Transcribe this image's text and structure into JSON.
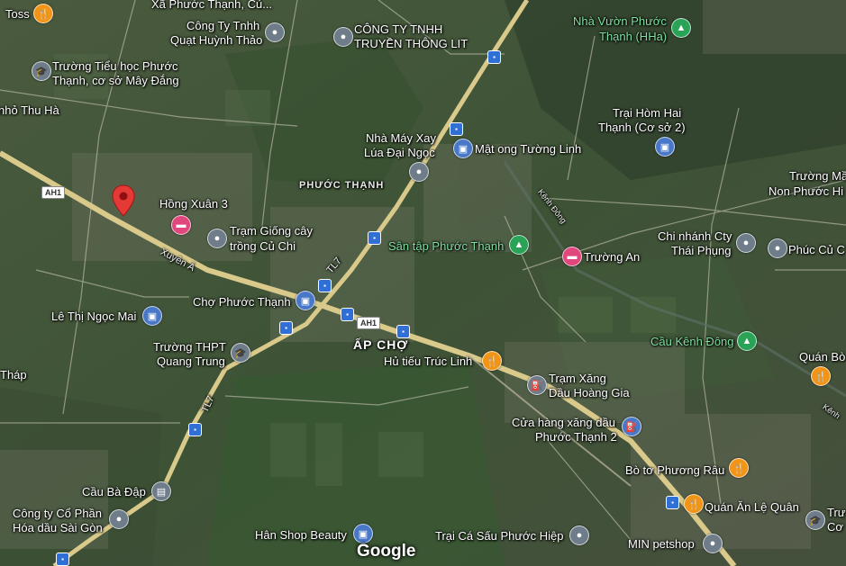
{
  "map": {
    "brand": "Google",
    "area_labels": [
      {
        "id": "phuoc-thanh-area",
        "text": "PHƯỚC THẠNH"
      },
      {
        "id": "ap-cho",
        "text": "ẤP CHỢ"
      }
    ],
    "road_labels": {
      "ah1_a": "AH1",
      "ah1_b": "AH1",
      "tl7_a": "TL7",
      "tl7_b": "TL7",
      "xuyen_a": "Xuyên Á",
      "kenh_dong": "Kênh Đông",
      "kenh_edge": "Kênh"
    },
    "places": {
      "xa_phuoc_thanh": "Xã Phước Thạnh, Củ...",
      "toss": "Toss",
      "cong_ty_quat_l1": "Công Ty Tnhh",
      "cong_ty_quat_l2": "Quạt Huỳnh Thảo",
      "truyen_thong_l1": "CÔNG TY TNHH",
      "truyen_thong_l2": "TRUYỀN THÔNG LIT",
      "nha_vuon_l1": "Nhà Vườn Phước",
      "nha_vuon_l2": "Thạnh (HHa)",
      "truong_tieu_hoc_l1": "Trường Tiểu học Phước",
      "truong_tieu_hoc_l2": "Thạnh, cơ sở Mây Đắng",
      "tho_thu_ha": "nhỏ Thu Hà",
      "trai_hom_l1": "Trại Hòm Hai",
      "trai_hom_l2": "Thạnh (Cơ sở 2)",
      "nha_may_l1": "Nhà Máy Xay",
      "nha_may_l2": "Lúa Đại Ngọc",
      "mat_ong": "Mật ong Tường Linh",
      "truong_mam_l1": "Trường Mầ",
      "truong_mam_l2": "Non Phước Hi",
      "hong_xuan": "Hồng Xuân 3",
      "tram_giong_l1": "Trạm Giống cây",
      "tram_giong_l2": "trồng Củ Chi",
      "san_tap": "Sân tập Phước Thạnh",
      "truong_an": "Trường An",
      "chi_nhanh_l1": "Chi nhánh Cty",
      "chi_nhanh_l2": "Thái Phụng",
      "phuc_cu": "Phúc Củ C",
      "cho_phuoc_thanh": "Chợ Phước Thạnh",
      "le_thi_ngoc_mai": "Lê Thị Ngọc Mai",
      "truong_thpt_l1": "Trường THPT",
      "truong_thpt_l2": "Quang Trung",
      "cau_kenh_dong": "Cầu Kênh Đông",
      "quan_bo": "Quán Bò",
      "hu_tieu": "Hủ tiếu Trúc Linh",
      "thap": "Tháp",
      "tram_xang_l1": "Trạm Xăng",
      "tram_xang_l2": "Dầu Hoàng Gia",
      "cua_hang_l1": "Cửa hàng xăng dầu",
      "cua_hang_l2": "Phước Thạnh 2",
      "bo_to": "Bò tơ Phương Râu",
      "cau_ba_dap": "Cầu Bà Đập",
      "cong_ty_co_phan_l1": "Công ty Cổ Phần",
      "cong_ty_co_phan_l2": "Hóa dầu Sài Gòn",
      "quan_an": "Quán Ăn Lệ Quân",
      "tru_l1": "Trư",
      "tru_l2": "Cơ",
      "han_shop": "Hân Shop Beauty",
      "trai_ca_sau": "Trại Cá Sấu Phước Hiệp",
      "min_petshop": "MIN petshop"
    }
  }
}
